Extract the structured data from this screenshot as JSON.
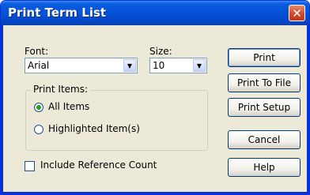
{
  "window": {
    "title": "Print Term List",
    "close_symbol": "✕"
  },
  "font": {
    "label": "Font:",
    "value": "Arial"
  },
  "size": {
    "label": "Size:",
    "value": "10"
  },
  "print_items": {
    "title": "Print Items:",
    "options": [
      {
        "label": "All Items",
        "selected": true
      },
      {
        "label": "Highlighted Item(s)",
        "selected": false
      }
    ]
  },
  "include_reference_count": {
    "label": "Include Reference Count",
    "checked": false
  },
  "buttons": {
    "print": "Print",
    "print_to_file": "Print To File",
    "print_setup": "Print Setup",
    "cancel": "Cancel",
    "help": "Help"
  },
  "colors": {
    "titlebar": "#0552d8",
    "dialog_bg": "#ece9d8",
    "radio_dot": "#21a121"
  }
}
